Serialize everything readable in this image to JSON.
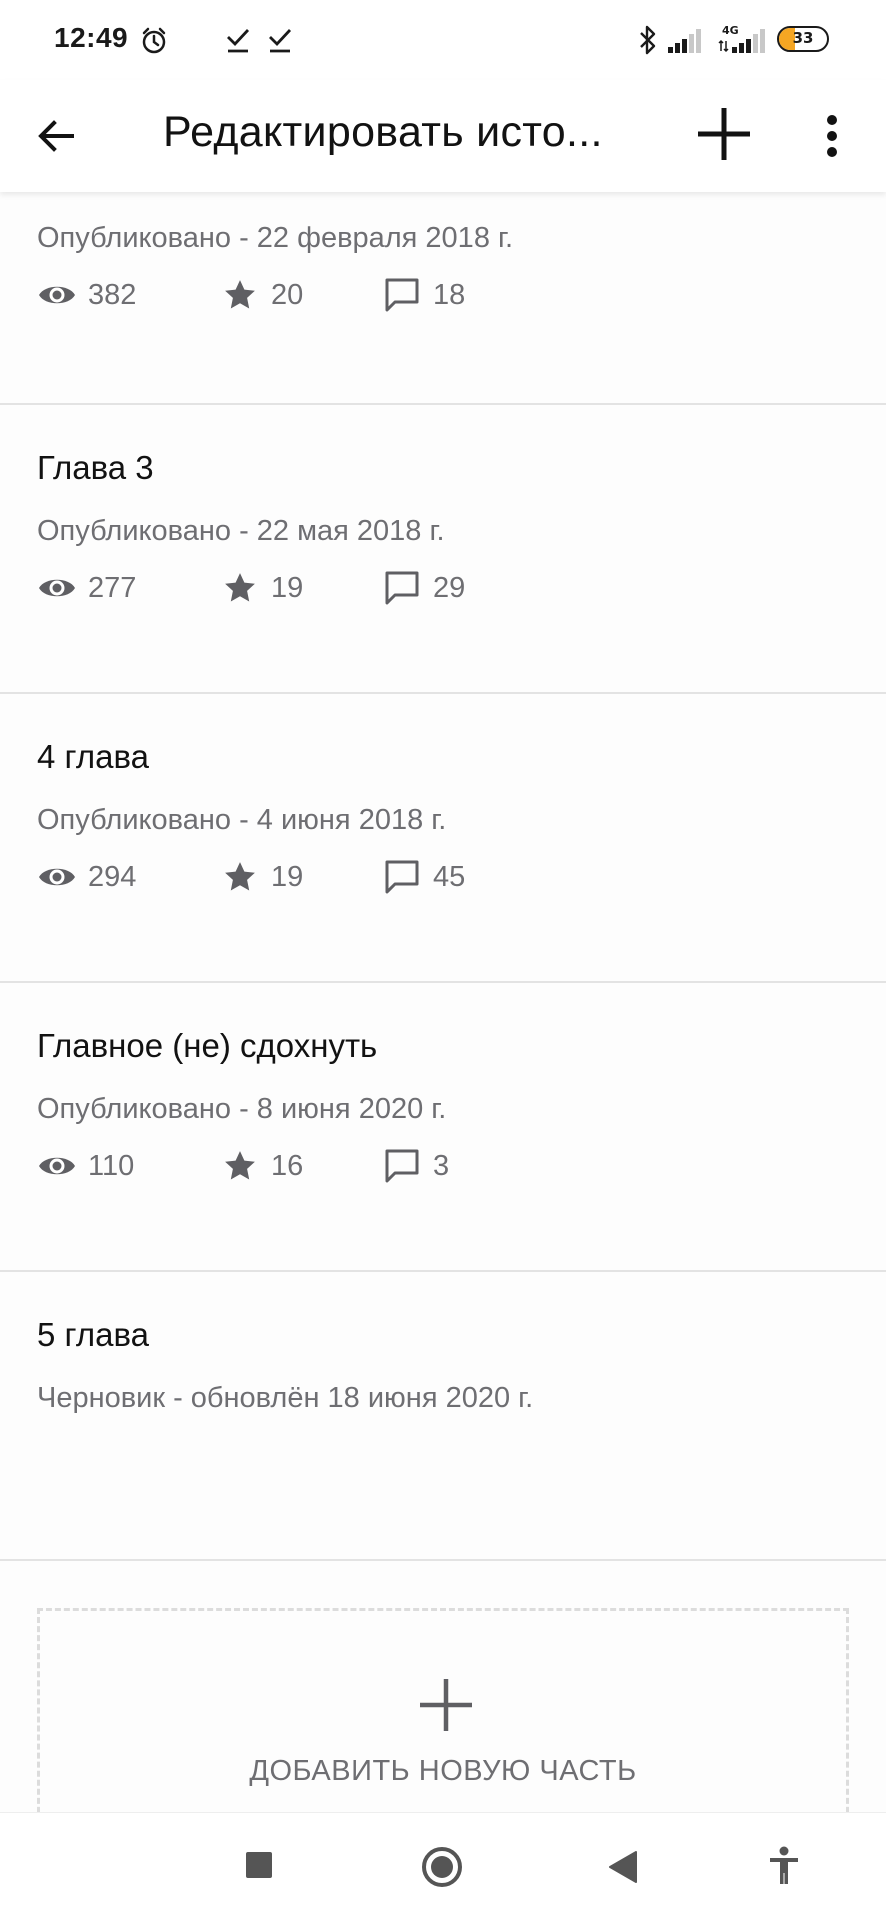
{
  "status_bar": {
    "time": "12:49",
    "network": "4G",
    "battery": "33",
    "battery_level": 0.33
  },
  "app_bar": {
    "title": "Редактировать исто...",
    "icons": {
      "back": "arrow-back-icon",
      "add": "plus-icon",
      "more": "more-vert-icon"
    }
  },
  "parts": [
    {
      "title": "",
      "status": "Опубликовано - 22 февраля 2018 г.",
      "views": "382",
      "votes": "20",
      "comments": "18"
    },
    {
      "title": "Глава 3",
      "status": "Опубликовано - 22 мая 2018 г.",
      "views": "277",
      "votes": "19",
      "comments": "29"
    },
    {
      "title": "4 глава",
      "status": "Опубликовано - 4 июня 2018 г.",
      "views": "294",
      "votes": "19",
      "comments": "45"
    },
    {
      "title": "Главное (не) сдохнуть",
      "status": "Опубликовано - 8 июня 2020 г.",
      "views": "110",
      "votes": "16",
      "comments": "3"
    },
    {
      "title": "5 глава",
      "status": "Черновик - обновлён 18 июня 2020 г."
    }
  ],
  "add_part": {
    "label": "ДОБАВИТЬ НОВУЮ ЧАСТЬ"
  },
  "colors": {
    "text_primary": "#121212",
    "text_secondary": "#6e6e72",
    "divider": "#e3e3e3",
    "battery_accent": "#f5a623"
  }
}
